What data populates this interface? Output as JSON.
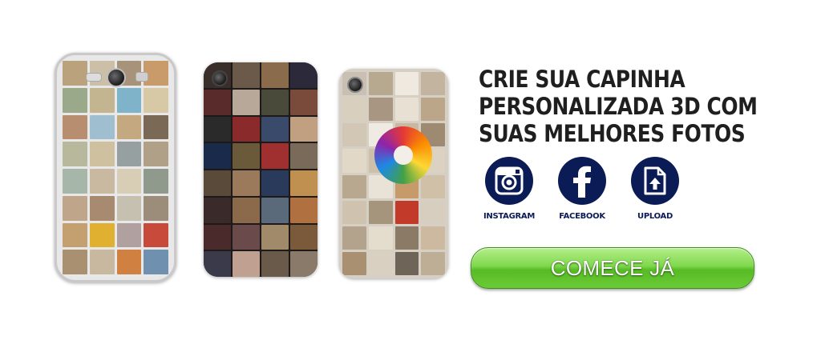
{
  "headline": {
    "line1": "CRIE SUA CAPINHA",
    "line2": "PERSONALIZADA 3D COM",
    "line3": "SUAS MELHORES FOTOS"
  },
  "sources": [
    {
      "label": "INSTAGRAM",
      "icon": "instagram-icon"
    },
    {
      "label": "FACEBOOK",
      "icon": "facebook-icon"
    },
    {
      "label": "UPLOAD",
      "icon": "upload-icon"
    }
  ],
  "cta": {
    "label": "COMECE JÁ"
  },
  "colors": {
    "icon_circle": "#0b1b55",
    "cta_green": "#6bcb37",
    "headline": "#1f1f1f"
  },
  "phones": {
    "galaxy_tiles": [
      "#b9a27c",
      "#cbbfa8",
      "#a7937a",
      "#c99a6a",
      "#9aa98a",
      "#c2b58f",
      "#7fb3c9",
      "#d8c9a6",
      "#b78f70",
      "#9fbfd0",
      "#c4a880",
      "#7a6a55",
      "#b8b89c",
      "#cfc0a0",
      "#96a0a0",
      "#b0a088",
      "#a6b6a9",
      "#c9b9a0",
      "#d8cdb5",
      "#8f9a8c",
      "#bfa58a",
      "#a88a70",
      "#c6c0b0",
      "#9c8c7a",
      "#c4a070",
      "#e0b030",
      "#b0a0a0",
      "#c84a3a",
      "#a89070",
      "#c8b8a0",
      "#d08040",
      "#7090b0"
    ],
    "dark_tiles": [
      "#3a2e2a",
      "#6b5a4a",
      "#8a6c4c",
      "#2c2a3a",
      "#5a2b2b",
      "#b8a89a",
      "#4a4a3a",
      "#7a4a3a",
      "#2a2a2a",
      "#8a2a2a",
      "#3a4a6a",
      "#c0a080",
      "#1a2a4a",
      "#6a5a3a",
      "#a03030",
      "#7a6a5a",
      "#5a4a3a",
      "#9a7a5a",
      "#2a3a5a",
      "#c09050",
      "#3a2a2a",
      "#8a6a4a",
      "#5a6a7a",
      "#b07040",
      "#4a2a2a",
      "#6a4a4a",
      "#a08a6a",
      "#7a5a3a",
      "#3a3a4a",
      "#c0a090",
      "#6a5a4a",
      "#8a7a6a"
    ],
    "light_tiles": [
      "#c9bfb2",
      "#b7a890",
      "#efe9df",
      "#c2b49e",
      "#d9cfbf",
      "#a89682",
      "#e8e0d2",
      "#bba68a",
      "#d2c6b4",
      "#f0ebe2",
      "#c8b8a0",
      "#9e8a70",
      "#e2d8c8",
      "#cdbfa9",
      "#b9a58b",
      "#dcd2c2",
      "#b8a890",
      "#e9e2d6",
      "#c79a6a",
      "#d0c0a8",
      "#cfc3b0",
      "#a6957d",
      "#c23a2a",
      "#d8cec0",
      "#b3a38c",
      "#e4dccd",
      "#8a7a66",
      "#cdb9a0",
      "#a89070",
      "#d9d0c2",
      "#6e6458",
      "#bfae96"
    ]
  }
}
